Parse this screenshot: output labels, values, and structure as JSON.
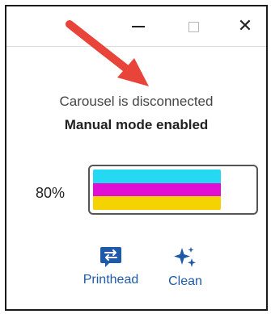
{
  "window": {
    "minimize_label": "Minimize",
    "maximize_label": "Maximize",
    "close_label": "Close"
  },
  "status": {
    "connection_text": "Carousel is disconnected",
    "mode_text": "Manual mode enabled"
  },
  "ink": {
    "percent_label": "80%",
    "level": 0.8,
    "colors": [
      "#25d9f2",
      "#e10fd6",
      "#f5d300"
    ]
  },
  "actions": [
    {
      "label": "Printhead",
      "icon": "printhead-swap-icon"
    },
    {
      "label": "Clean",
      "icon": "sparkle-clean-icon"
    }
  ],
  "colors": {
    "accent_blue": "#1e5aa8",
    "annotation_arrow": "#e8443a"
  }
}
